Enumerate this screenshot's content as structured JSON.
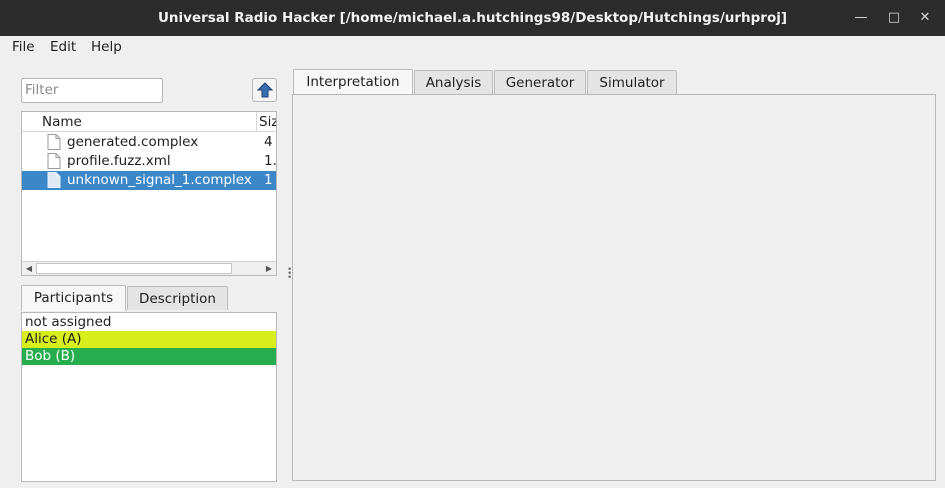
{
  "window": {
    "title": "Universal Radio Hacker [/home/michael.a.hutchings98/Desktop/Hutchings/urhproj]",
    "minimize_icon": "minimize-icon",
    "maximize_icon": "maximize-icon",
    "close_icon": "close-icon"
  },
  "menu": {
    "file": "File",
    "edit": "Edit",
    "help": "Help"
  },
  "filter": {
    "placeholder": "Filter"
  },
  "file_tree": {
    "columns": {
      "name": "Name",
      "size": "Siz"
    },
    "rows": [
      {
        "name": "generated.complex",
        "size": "4",
        "icon": "file-icon",
        "selected": false
      },
      {
        "name": "profile.fuzz.xml",
        "size": "1.",
        "icon": "file-icon",
        "selected": false
      },
      {
        "name": "unknown_signal_1.complex",
        "size": "1",
        "icon": "file-icon",
        "selected": true
      }
    ]
  },
  "lower_tabs": {
    "participants": "Participants",
    "description": "Description"
  },
  "participants": [
    {
      "label": "not assigned",
      "color": "#ffffff"
    },
    {
      "label": "Alice (A)",
      "color": "#d7ee1c"
    },
    {
      "label": "Bob (B)",
      "color": "#26ae4e"
    }
  ],
  "main_tabs": {
    "interpretation": "Interpretation",
    "analysis": "Analysis",
    "generator": "Generator",
    "simulator": "Simulator"
  },
  "colors": {
    "selection": "#3b87c8",
    "titlebar": "#2c2c2c"
  }
}
